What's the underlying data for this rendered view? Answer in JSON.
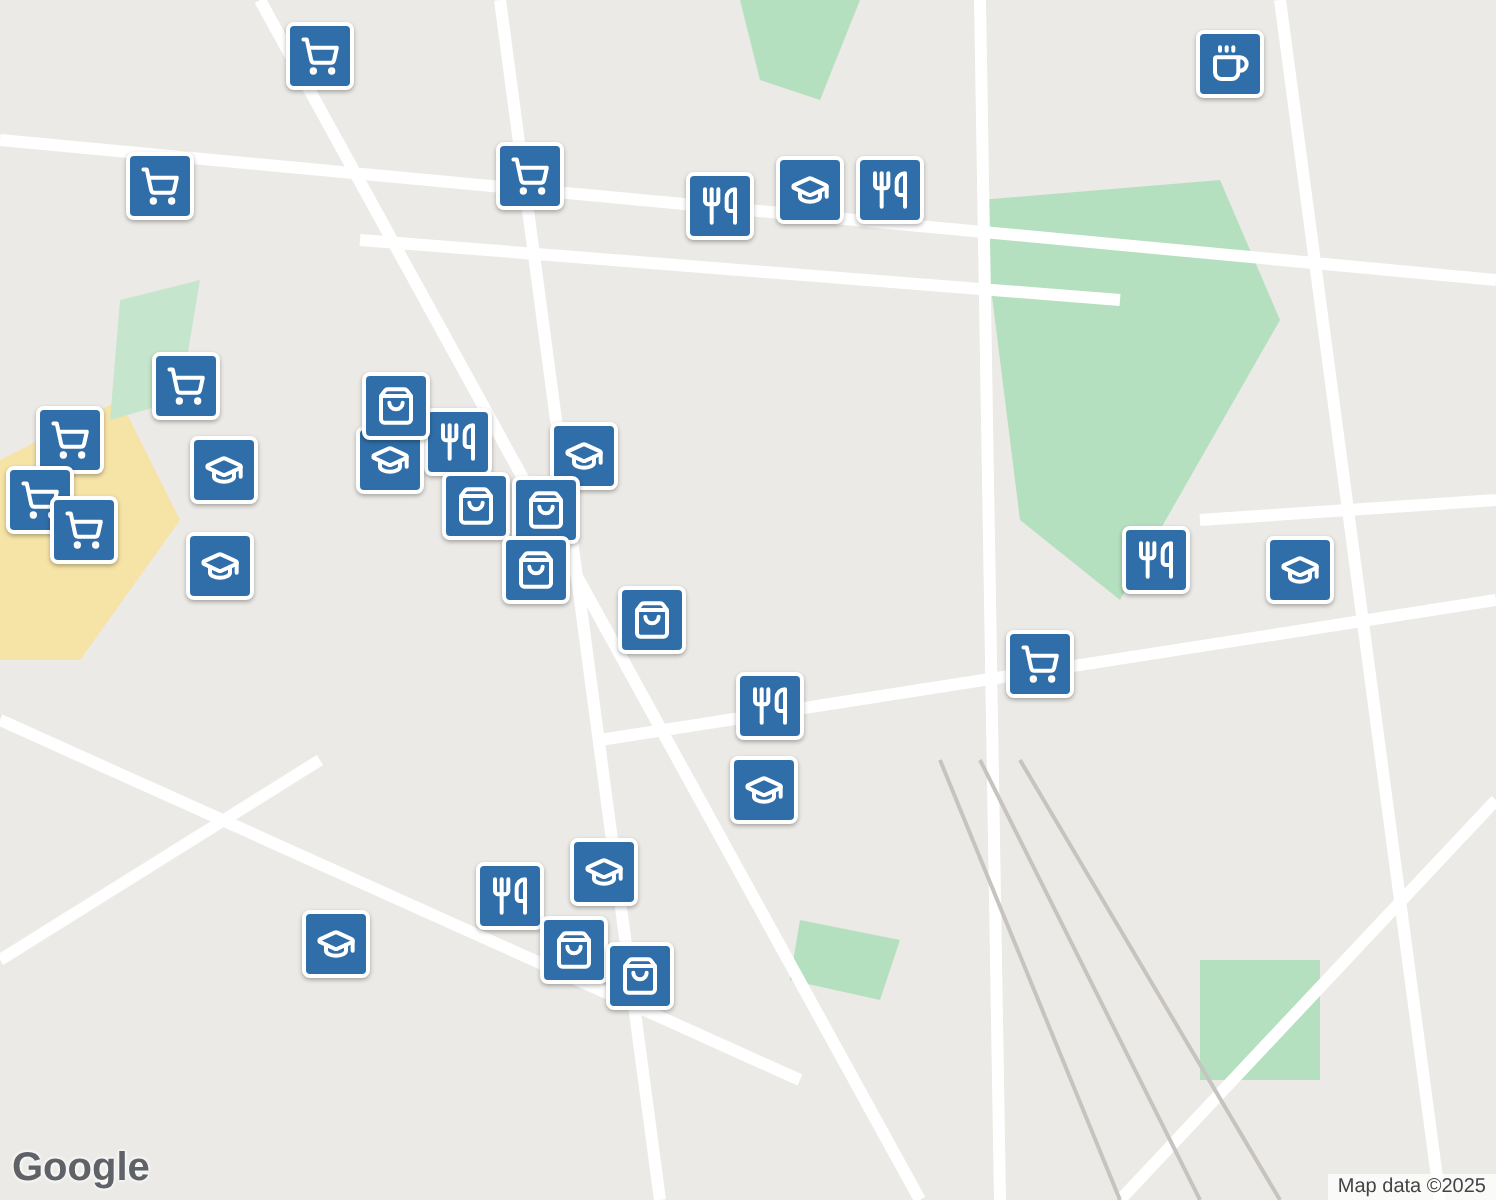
{
  "markers": [
    {
      "kind": "cart"
    },
    {
      "kind": "cart"
    },
    {
      "kind": "cart"
    },
    {
      "kind": "cart"
    },
    {
      "kind": "cart"
    },
    {
      "kind": "cart"
    },
    {
      "kind": "cart"
    },
    {
      "kind": "cart"
    },
    {
      "kind": "coffee"
    },
    {
      "kind": "food"
    },
    {
      "kind": "food"
    },
    {
      "kind": "food"
    },
    {
      "kind": "food"
    },
    {
      "kind": "food"
    },
    {
      "kind": "food"
    },
    {
      "kind": "school"
    },
    {
      "kind": "school"
    },
    {
      "kind": "school"
    },
    {
      "kind": "school"
    },
    {
      "kind": "school"
    },
    {
      "kind": "school"
    },
    {
      "kind": "school"
    },
    {
      "kind": "school"
    },
    {
      "kind": "school"
    },
    {
      "kind": "bag"
    },
    {
      "kind": "bag"
    },
    {
      "kind": "bag"
    },
    {
      "kind": "bag"
    },
    {
      "kind": "bag"
    },
    {
      "kind": "bag"
    },
    {
      "kind": "bag"
    }
  ],
  "logo": "Google",
  "attribution": "Map data ©2025"
}
